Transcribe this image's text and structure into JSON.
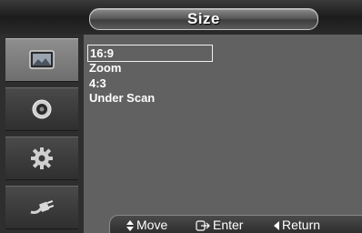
{
  "header": {
    "title": "Size"
  },
  "sidebar": {
    "items": [
      {
        "icon": "picture-icon",
        "active": true
      },
      {
        "icon": "sound-icon",
        "active": false
      },
      {
        "icon": "setup-gear-icon",
        "active": false
      },
      {
        "icon": "input-plug-icon",
        "active": false
      }
    ]
  },
  "menu": {
    "options": [
      "16:9",
      "Zoom",
      "4:3",
      "Under Scan"
    ],
    "selected": "16:9"
  },
  "footer": {
    "move_label": "Move",
    "enter_label": "Enter",
    "return_label": "Return"
  },
  "colors": {
    "highlight_border": "#f0f0f0",
    "text": "#ffffff"
  }
}
